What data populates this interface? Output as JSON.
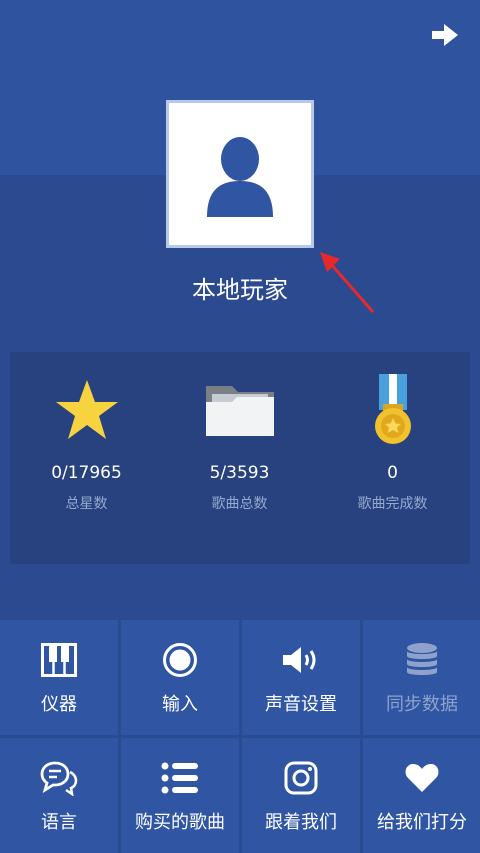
{
  "profile": {
    "name": "本地玩家"
  },
  "stats": [
    {
      "icon": "star-icon",
      "value": "0/17965",
      "label": "总星数"
    },
    {
      "icon": "folder-icon",
      "value": "5/3593",
      "label": "歌曲总数"
    },
    {
      "icon": "medal-icon",
      "value": "0",
      "label": "歌曲完成数"
    }
  ],
  "menu": [
    {
      "icon": "piano-icon",
      "label": "仪器"
    },
    {
      "icon": "record-icon",
      "label": "输入"
    },
    {
      "icon": "speaker-icon",
      "label": "声音设置"
    },
    {
      "icon": "database-icon",
      "label": "同步数据"
    },
    {
      "icon": "chat-icon",
      "label": "语言"
    },
    {
      "icon": "list-icon",
      "label": "购买的歌曲"
    },
    {
      "icon": "instagram-icon",
      "label": "跟着我们"
    },
    {
      "icon": "heart-icon",
      "label": "给我们打分"
    }
  ],
  "colors": {
    "accent_star": "#f6d33f",
    "medal_ribbon": "#4aa0dc",
    "annotation_arrow": "#e8292b"
  }
}
